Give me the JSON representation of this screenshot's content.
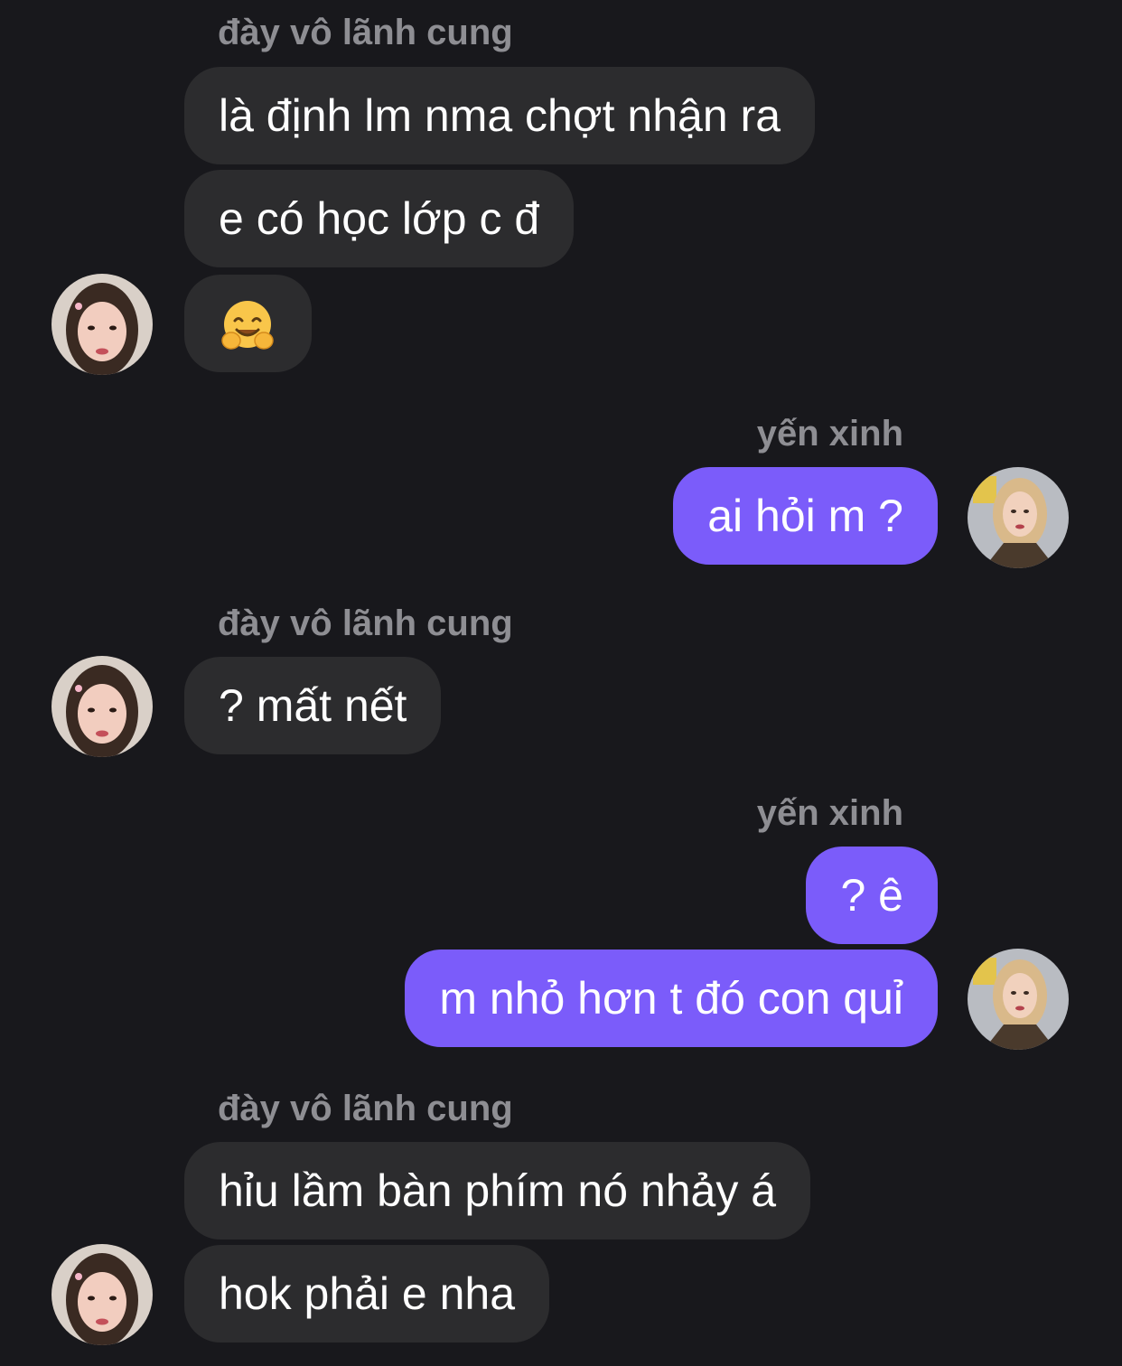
{
  "conversation": {
    "participants": {
      "them": {
        "name": "đày vô lãnh cung"
      },
      "me": {
        "name": "yến xinh"
      }
    },
    "messages": [
      {
        "from": "them",
        "text": "là định lm nma chợt nhận ra"
      },
      {
        "from": "them",
        "text": "e có học lớp c đ"
      },
      {
        "from": "them",
        "emoji": "hugging-face",
        "text": ""
      },
      {
        "from": "me",
        "text": "ai hỏi m ?"
      },
      {
        "from": "them",
        "text": "? mất nết"
      },
      {
        "from": "me",
        "text": "? ê"
      },
      {
        "from": "me",
        "text": "m nhỏ hơn t đó con quỉ"
      },
      {
        "from": "them",
        "text": "hỉu lầm bàn phím nó nhảy á"
      },
      {
        "from": "them",
        "text": "hok phải e nha"
      }
    ]
  },
  "colors": {
    "background": "#18181c",
    "incoming_bubble": "#2c2c2e",
    "outgoing_bubble": "#7b5cfa",
    "sender_name": "#8e8e93",
    "text": "#ffffff"
  }
}
